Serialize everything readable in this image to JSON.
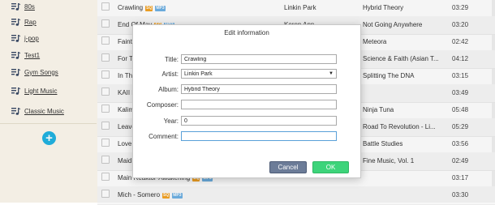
{
  "sidebar": {
    "playlists": [
      {
        "label": "80s",
        "icon": "playlist-icon"
      },
      {
        "label": "Rap",
        "icon": "playlist-icon"
      },
      {
        "label": "j-pop",
        "icon": "playlist-icon"
      },
      {
        "label": "Test1",
        "icon": "playlist-icon"
      },
      {
        "label": "Gym Songs",
        "icon": "playlist-icon"
      },
      {
        "label": "Light Music",
        "icon": "playlist-icon"
      },
      {
        "label": "Classic Music",
        "icon": "playlist-icon"
      }
    ],
    "add_label": "+"
  },
  "songs": [
    {
      "title": "Crawling",
      "badges": [
        "SQ",
        "MP3"
      ],
      "artist": "Linkin Park",
      "album": "Hybrid Theory",
      "time": "03:29"
    },
    {
      "title": "End Of May",
      "badges": [
        "SQ",
        "MP3"
      ],
      "artist": "Keren Ann",
      "album": "Not Going Anywhere",
      "time": "03:20"
    },
    {
      "title": "Faint",
      "badges": [],
      "artist": "",
      "album": "Meteora",
      "time": "02:42"
    },
    {
      "title": "For Th",
      "badges": [],
      "artist": "",
      "album": "Science & Faith (Asian T...",
      "time": "04:12"
    },
    {
      "title": "In The",
      "badges": [],
      "artist": "",
      "album": "Splitting The DNA",
      "time": "03:15"
    },
    {
      "title": "KAII h",
      "badges": [],
      "artist": "",
      "album": "",
      "time": "03:49"
    },
    {
      "title": "Kalimb",
      "badges": [],
      "artist": "",
      "album": "Ninja Tuna",
      "time": "05:48"
    },
    {
      "title": "Leave",
      "badges": [],
      "artist": "",
      "album": "Road To Revolution - Li...",
      "time": "05:29"
    },
    {
      "title": "Love &",
      "badges": [],
      "artist": "",
      "album": "Battle Studies",
      "time": "03:56"
    },
    {
      "title": "Maid w",
      "badges": [],
      "artist": "",
      "album": "Fine Music, Vol. 1",
      "time": "02:49"
    },
    {
      "title": "Main Reaktor-Awakening",
      "badges": [
        "SQ",
        "MP3"
      ],
      "artist": "",
      "album": "",
      "time": "03:17"
    },
    {
      "title": "Mich - Somero",
      "badges": [
        "SQ",
        "MP3"
      ],
      "artist": "",
      "album": "",
      "time": "03:30"
    }
  ],
  "dialog": {
    "title": "Edit information",
    "fields": {
      "title_label": "Title:",
      "title_value": "Crawling",
      "artist_label": "Artist:",
      "artist_value": "Linkin Park",
      "album_label": "Album:",
      "album_value": "Hybrid Theory",
      "composer_label": "Composer:",
      "composer_value": "",
      "year_label": "Year:",
      "year_value": "0",
      "comment_label": "Comment:",
      "comment_value": ""
    },
    "cancel_label": "Cancel",
    "ok_label": "OK"
  },
  "colors": {
    "accent_blue": "#21b4e2",
    "ok_green": "#3dd47a",
    "cancel_gray": "#6c7c98",
    "badge_sq": "#f4a324",
    "badge_mp3": "#6fb1e4"
  }
}
